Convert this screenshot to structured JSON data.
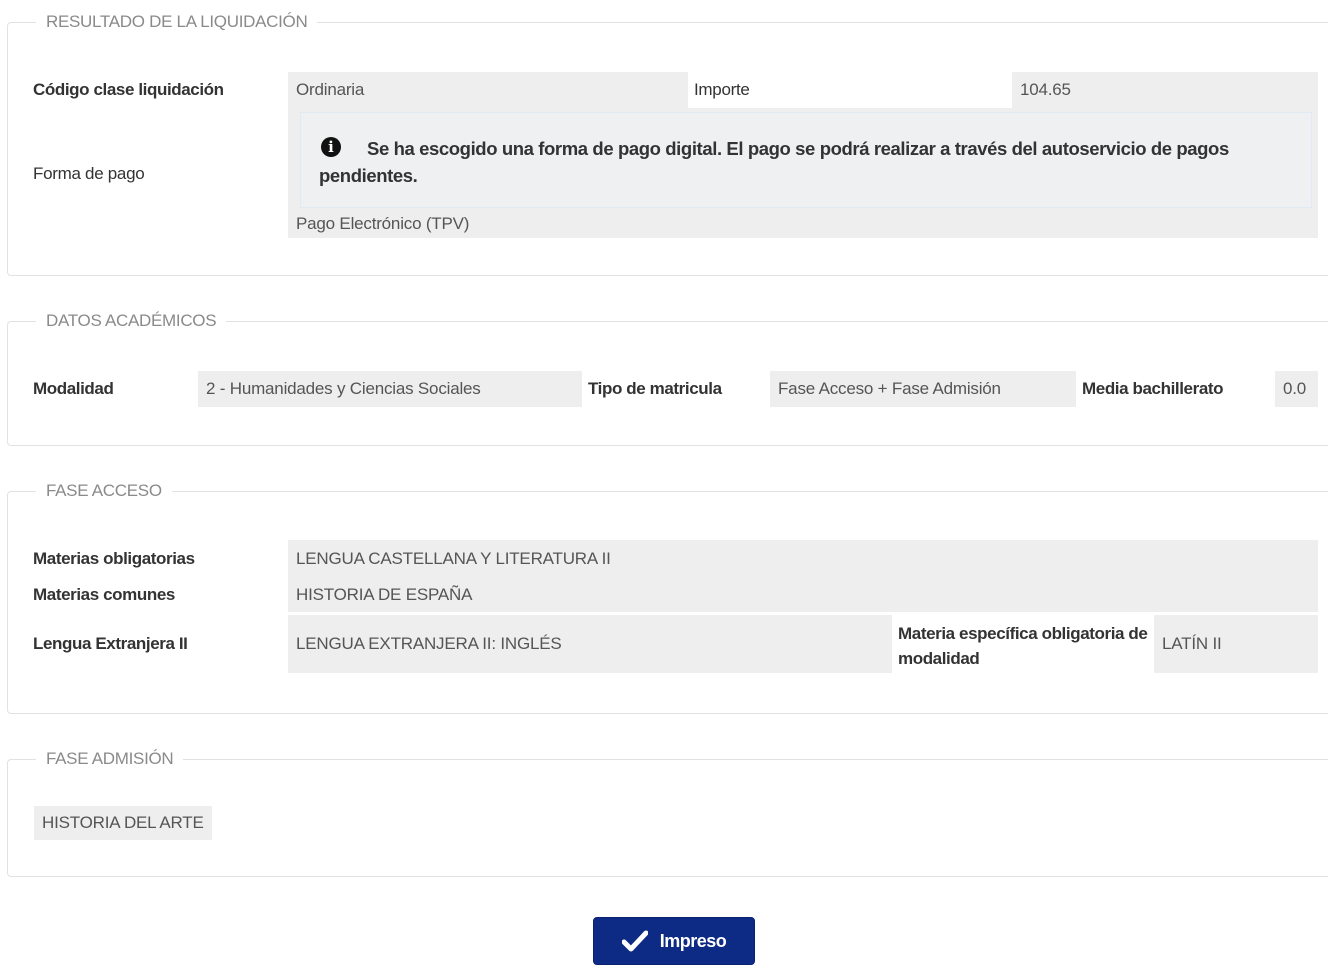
{
  "liquidacion": {
    "legend": "RESULTADO DE LA LIQUIDACIÓN",
    "codigo_label": "Código clase liquidación",
    "codigo_value": "Ordinaria",
    "importe_label": "Importe",
    "importe_value": "104.65",
    "forma_pago_label": "Forma de pago",
    "info_message": "Se ha escogido una forma de pago digital. El pago se podrá realizar a través del autoservicio de pagos pendientes.",
    "forma_pago_value": "Pago Electrónico (TPV)"
  },
  "academicos": {
    "legend": "DATOS ACADÉMICOS",
    "modalidad_label": "Modalidad",
    "modalidad_value": "2 - Humanidades y Ciencias Sociales",
    "tipo_label": "Tipo de matricula",
    "tipo_value": "Fase Acceso + Fase Admisión",
    "media_label": "Media bachillerato",
    "media_value": "0.0"
  },
  "acceso": {
    "legend": "FASE ACCESO",
    "obligatorias_label": "Materias obligatorias",
    "obligatorias_value": "LENGUA CASTELLANA Y LITERATURA II",
    "comunes_label": "Materias comunes",
    "comunes_value": "HISTORIA DE ESPAÑA",
    "lengua_label": "Lengua Extranjera II",
    "lengua_value": "LENGUA EXTRANJERA II: INGLÉS",
    "especifica_label": "Materia específica obligatoria de modalidad",
    "especifica_value": "LATÍN II"
  },
  "admision": {
    "legend": "FASE ADMISIÓN",
    "materia_value": "HISTORIA DEL ARTE"
  },
  "actions": {
    "impreso_label": "Impreso"
  },
  "icons": {
    "info": "info-circle-icon",
    "check": "check-icon"
  },
  "colors": {
    "button_bg": "#0d2a85",
    "field_bg": "#eeeeee"
  }
}
